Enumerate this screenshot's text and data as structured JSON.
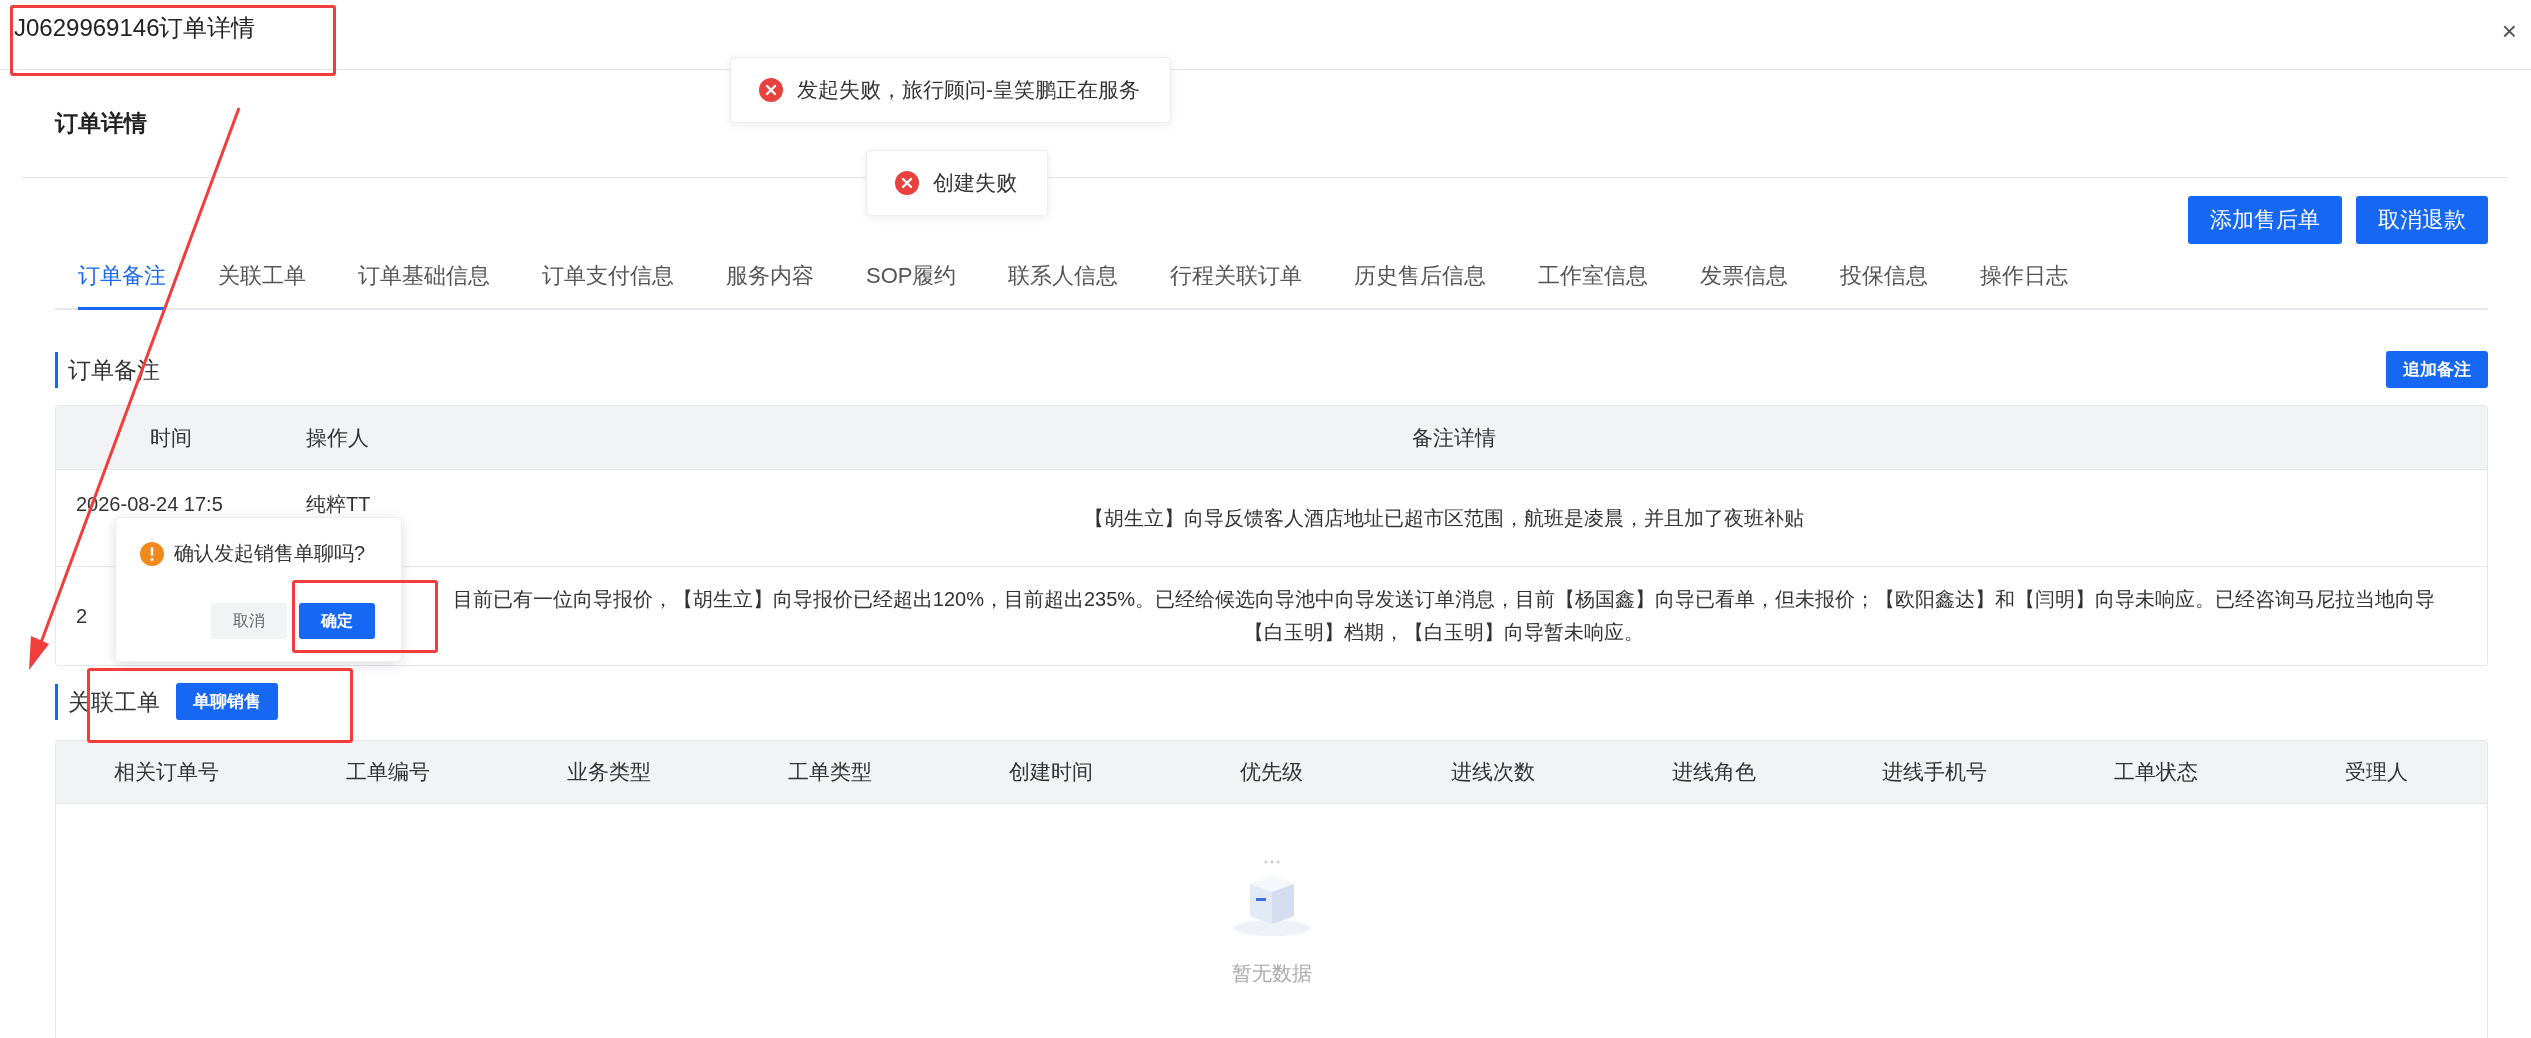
{
  "window": {
    "title": "J0629969146订单详情",
    "close": "×"
  },
  "toasts": [
    {
      "kind": "error",
      "text": "发起失败，旅行顾问-皇笑鹏正在服务"
    },
    {
      "kind": "error",
      "text": "创建失败"
    }
  ],
  "page_title": "订单详情",
  "actions": [
    "添加售后单",
    "取消退款"
  ],
  "tabs": [
    {
      "label": "订单备注",
      "selected": true
    },
    {
      "label": "关联工单",
      "selected": false
    },
    {
      "label": "订单基础信息",
      "selected": false
    },
    {
      "label": "订单支付信息",
      "selected": false
    },
    {
      "label": "服务内容",
      "selected": false
    },
    {
      "label": "SOP履约",
      "selected": false
    },
    {
      "label": "联系人信息",
      "selected": false
    },
    {
      "label": "行程关联订单",
      "selected": false
    },
    {
      "label": "历史售后信息",
      "selected": false
    },
    {
      "label": "工作室信息",
      "selected": false
    },
    {
      "label": "发票信息",
      "selected": false
    },
    {
      "label": "投保信息",
      "selected": false
    },
    {
      "label": "操作日志",
      "selected": false
    }
  ],
  "notes_section": {
    "title": "订单备注",
    "button": "追加备注",
    "columns": [
      "时间",
      "操作人",
      "备注详情"
    ],
    "rows": [
      {
        "time": "2026-08-24 17:5",
        "operator": "纯粹TT",
        "detail": "【胡生立】向导反馈客人酒店地址已超市区范围，航班是凌晨，并且加了夜班补贴"
      },
      {
        "time": "2",
        "detail": "目前已有一位向导报价，【胡生立】向导报价已经超出120%，目前超出235%。已经给候选向导池中向导发送订单消息，目前【杨国鑫】向导已看单，但未报价；【欧阳鑫达】和【闫明】向导未响应。已经咨询马尼拉当地向导【白玉明】档期，【白玉明】向导暂未响应。"
      }
    ]
  },
  "popconfirm": {
    "kind": "warning",
    "message": "确认发起销售单聊吗?",
    "cancel": "取消",
    "confirm": "确定"
  },
  "tickets_section": {
    "title": "关联工单",
    "button": "单聊销售",
    "columns": [
      "相关订单号",
      "工单编号",
      "业务类型",
      "工单类型",
      "创建时间",
      "优先级",
      "进线次数",
      "进线角色",
      "进线手机号",
      "工单状态",
      "受理人"
    ],
    "empty_text": "暂无数据"
  }
}
